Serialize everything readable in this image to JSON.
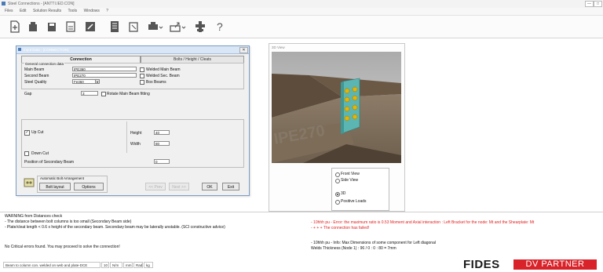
{
  "app": {
    "title": "Steel Connections - [ANTTI.IED.CON]",
    "window_buttons": [
      "—",
      "□"
    ]
  },
  "menu": [
    "Files",
    "Edit",
    "Solution Results",
    "Tools",
    "Windows",
    "?"
  ],
  "toolbar": {
    "icons": [
      "new-file-icon",
      "open-folder-icon",
      "save-icon",
      "calculator-icon",
      "edit-icon",
      "report-icon",
      "report-export-icon",
      "print-icon",
      "export-icon",
      "settings-icon",
      "help-icon"
    ],
    "help_label": "?"
  },
  "dialog": {
    "title": "Input Data - [CONNECTION]",
    "close_glyph": "✕",
    "tabs": [
      "Connection",
      "Bolts / Height / Cleats"
    ],
    "group_title": "General connection data",
    "main_beam_label": "Main Beam",
    "main_beam_value": "IPE360",
    "second_beam_label": "Second Beam",
    "second_beam_value": "IPE270",
    "steel_quality_label": "Steel Quality",
    "steel_quality_value": "Fe360",
    "welded_main_beam": "Welded Main Beam",
    "welded_sec_beam": "Welded Sec. Beam",
    "box_beams": "Box Beams",
    "gap_label": "Gap",
    "gap_value": "3",
    "rotate_main_beam": "Rotate Main Beam fitting",
    "up_cut_label": "Up Cut",
    "down_cut_label": "Down Cut",
    "height_label": "Height",
    "height_value": "40",
    "width_label": "Width",
    "width_value": "80",
    "position_label": "Position of Secondary Beam",
    "position_value": "0",
    "auto_bolt_label": "Automatic Bolt Arrangement",
    "bolt_layout_btn": "Bolt layout",
    "options_btn": "Options",
    "prev_btn": "<< Prev",
    "next_btn": "Next >>",
    "ok_btn": "OK",
    "cancel_btn": "Exit"
  },
  "view3d": {
    "title": "3D View",
    "beam_label": "IPE270",
    "options": {
      "front_view": "Front View",
      "side_view": "Side View",
      "three_d": "3D",
      "positive_loads": "Positive Loads"
    }
  },
  "messages": {
    "left": [
      "WARNING from Distances check",
      "- The distance between bolt columns is too small (Secondary Beam side)",
      "- Plate/cleat length < 0.6 x height of the secondary beam. Secondary beam may be laterally unstable. (SCI constructive advice)",
      "",
      "No Critical errors found. You may proceed to solve the connection!"
    ],
    "right_red": [
      "- 10hhh pu - Error: the maximum ratio is 0.53 Moment and Axial interaction : Left Bracket for the node: Mt and the Shearplate: Mt",
      "- + + + The connection has failed!"
    ],
    "right_black": [
      "- 10hhh pu - Info: Max Dimensions of some component for Left diagonal",
      "Welds Thickness (Node 1) : 96 / 0 : 0 : 80 = 7mm"
    ]
  },
  "status": {
    "segments": [
      "Beam to column con. welded on web and plate-DCE",
      "10",
      "N/m",
      "mm",
      "Rad",
      "kg"
    ]
  },
  "brand": {
    "fides": "FIDES",
    "partner": "DV PARTNER"
  },
  "colors": {
    "accent_blue": "#d9e6f5",
    "brand_red": "#d8232a",
    "error_red": "#e02020",
    "plate_teal": "#5bb6b3",
    "bolt_yellow": "#e8b400"
  }
}
